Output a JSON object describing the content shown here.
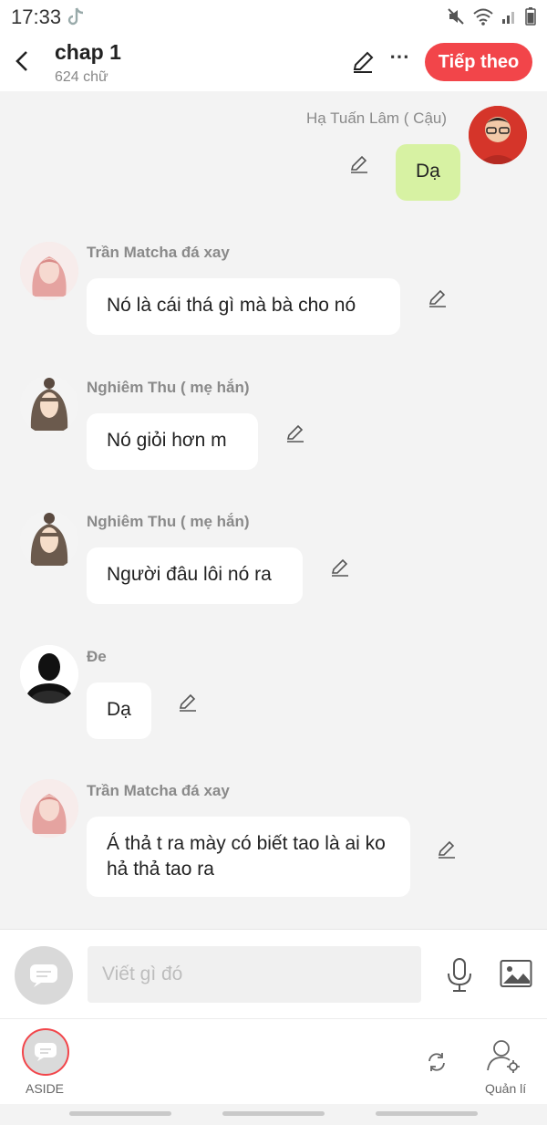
{
  "status_bar": {
    "time": "17:33"
  },
  "header": {
    "title": "chap 1",
    "word_count": "624 chữ",
    "next_label": "Tiếp theo",
    "more_label": "⋯",
    "accent": "#f2454a"
  },
  "messages": [
    {
      "sender": "Hạ Tuấn Lâm ( Cậu)",
      "text": "Dạ",
      "side": "right"
    },
    {
      "sender": "Trần Matcha đá xay",
      "text": "Nó là cái thá gì mà bà cho nó",
      "side": "left"
    },
    {
      "sender": "Nghiêm Thu ( mẹ hắn)",
      "text": "Nó giỏi hơn m",
      "side": "left"
    },
    {
      "sender": "Nghiêm Thu ( mẹ hắn)",
      "text": "Người đâu lôi nó ra",
      "side": "left"
    },
    {
      "sender": "Đe",
      "text": "Dạ",
      "side": "left"
    },
    {
      "sender": "Trần Matcha đá xay",
      "text": "Á thả t ra mày có biết tao là ai ko hả thả tao ra",
      "side": "left"
    }
  ],
  "composer": {
    "placeholder": "Viết gì đó"
  },
  "bottom_nav": {
    "aside_label": "ASIDE",
    "manage_label": "Quản lí"
  },
  "colors": {
    "my_bubble": "#d7f2a3",
    "background": "#f3f3f3"
  }
}
